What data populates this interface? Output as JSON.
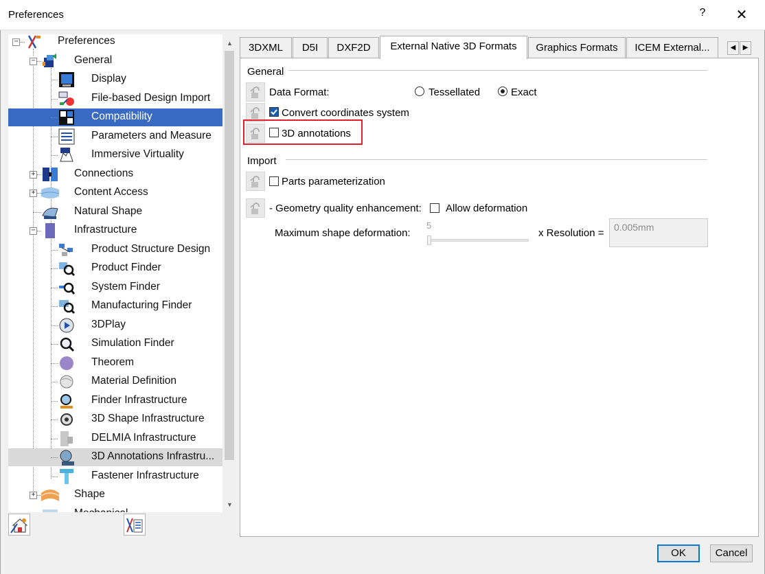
{
  "window": {
    "title": "Preferences",
    "help": "?",
    "close": "✕"
  },
  "tree": [
    {
      "label": "Preferences",
      "expander": "−"
    },
    {
      "label": "General",
      "expander": "−"
    },
    {
      "label": "Display"
    },
    {
      "label": "File-based Design Import"
    },
    {
      "label": "Compatibility",
      "selected": true
    },
    {
      "label": "Parameters and Measure"
    },
    {
      "label": "Immersive Virtuality"
    },
    {
      "label": "Connections",
      "expander": "+"
    },
    {
      "label": "Content Access",
      "expander": "+"
    },
    {
      "label": "Natural Shape"
    },
    {
      "label": "Infrastructure",
      "expander": "−"
    },
    {
      "label": "Product Structure Design"
    },
    {
      "label": "Product Finder"
    },
    {
      "label": "System Finder"
    },
    {
      "label": "Manufacturing Finder"
    },
    {
      "label": "3DPlay"
    },
    {
      "label": "Simulation Finder"
    },
    {
      "label": "Theorem"
    },
    {
      "label": "Material Definition"
    },
    {
      "label": "Finder Infrastructure"
    },
    {
      "label": "3D Shape Infrastructure"
    },
    {
      "label": "DELMIA Infrastructure"
    },
    {
      "label": "3D Annotations Infrastru...",
      "hover": true
    },
    {
      "label": "Fastener Infrastructure"
    },
    {
      "label": "Shape",
      "expander": "+"
    },
    {
      "label": "Mechanical"
    }
  ],
  "tabs": [
    {
      "label": "3DXML"
    },
    {
      "label": "D5I"
    },
    {
      "label": "DXF2D"
    },
    {
      "label": "External Native 3D Formats",
      "active": true
    },
    {
      "label": "Graphics Formats"
    },
    {
      "label": "ICEM External..."
    }
  ],
  "tab_arrows": {
    "left": "◀",
    "right": "▶"
  },
  "general": {
    "title": "General",
    "data_format_label": "Data Format:",
    "option_tessellated": "Tessellated",
    "option_exact": "Exact",
    "selected_format": "Exact",
    "convert_coords_label": "Convert coordinates system",
    "convert_coords_checked": true,
    "annotations_label": "3D annotations",
    "annotations_checked": false
  },
  "import": {
    "title": "Import",
    "parts_param_label": "Parts parameterization",
    "parts_param_checked": false,
    "geometry_label": "- Geometry quality enhancement:",
    "allow_deformation_label": "Allow deformation",
    "allow_deformation_checked": false,
    "max_deformation_label": "Maximum shape deformation:",
    "slider_value": "5",
    "resolution_label": "x Resolution =",
    "resolution_value": "0.005mm"
  },
  "buttons": {
    "ok": "OK",
    "cancel": "Cancel"
  },
  "colors": {
    "selection": "#3a6bc3",
    "highlight": "#e0202a",
    "checkbox_accent": "#1a5fb4"
  }
}
